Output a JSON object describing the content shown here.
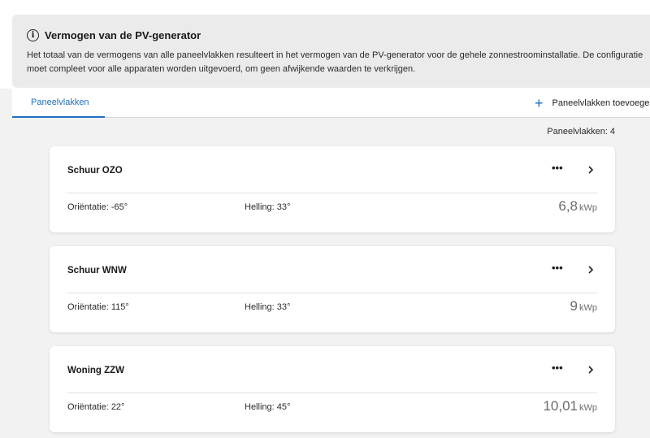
{
  "info": {
    "title": "Vermogen van de PV-generator",
    "icon": "info-icon",
    "text": "Het totaal van de vermogens van alle paneelvlakken resulteert in het vermogen van de PV-generator voor de gehele zonnestroominstallatie. De configuratie moet compleet voor alle apparaten worden uitgevoerd, om geen afwijkende waarden te verkrijgen."
  },
  "tabs": [
    {
      "label": "Paneelvlakken",
      "active": true
    }
  ],
  "add_button": {
    "label": "Paneelvlakken toevoegen",
    "icon": "plus-icon"
  },
  "count": {
    "label": "Paneelvlakken:",
    "value": "4"
  },
  "labels": {
    "orientation": "Oriëntatie:",
    "tilt": "Helling:",
    "unit": "kWp",
    "more": "•••"
  },
  "cards": [
    {
      "name": "Schuur OZO",
      "orientation": "-65°",
      "tilt": "33°",
      "power": "6,8"
    },
    {
      "name": "Schuur WNW",
      "orientation": "115°",
      "tilt": "33°",
      "power": "9"
    },
    {
      "name": "Woning ZZW",
      "orientation": "22°",
      "tilt": "45°",
      "power": "10,01"
    }
  ],
  "colors": {
    "accent": "#1f6fbf",
    "info_bg": "#ebebeb",
    "page_bg": "#f2f2f2"
  }
}
